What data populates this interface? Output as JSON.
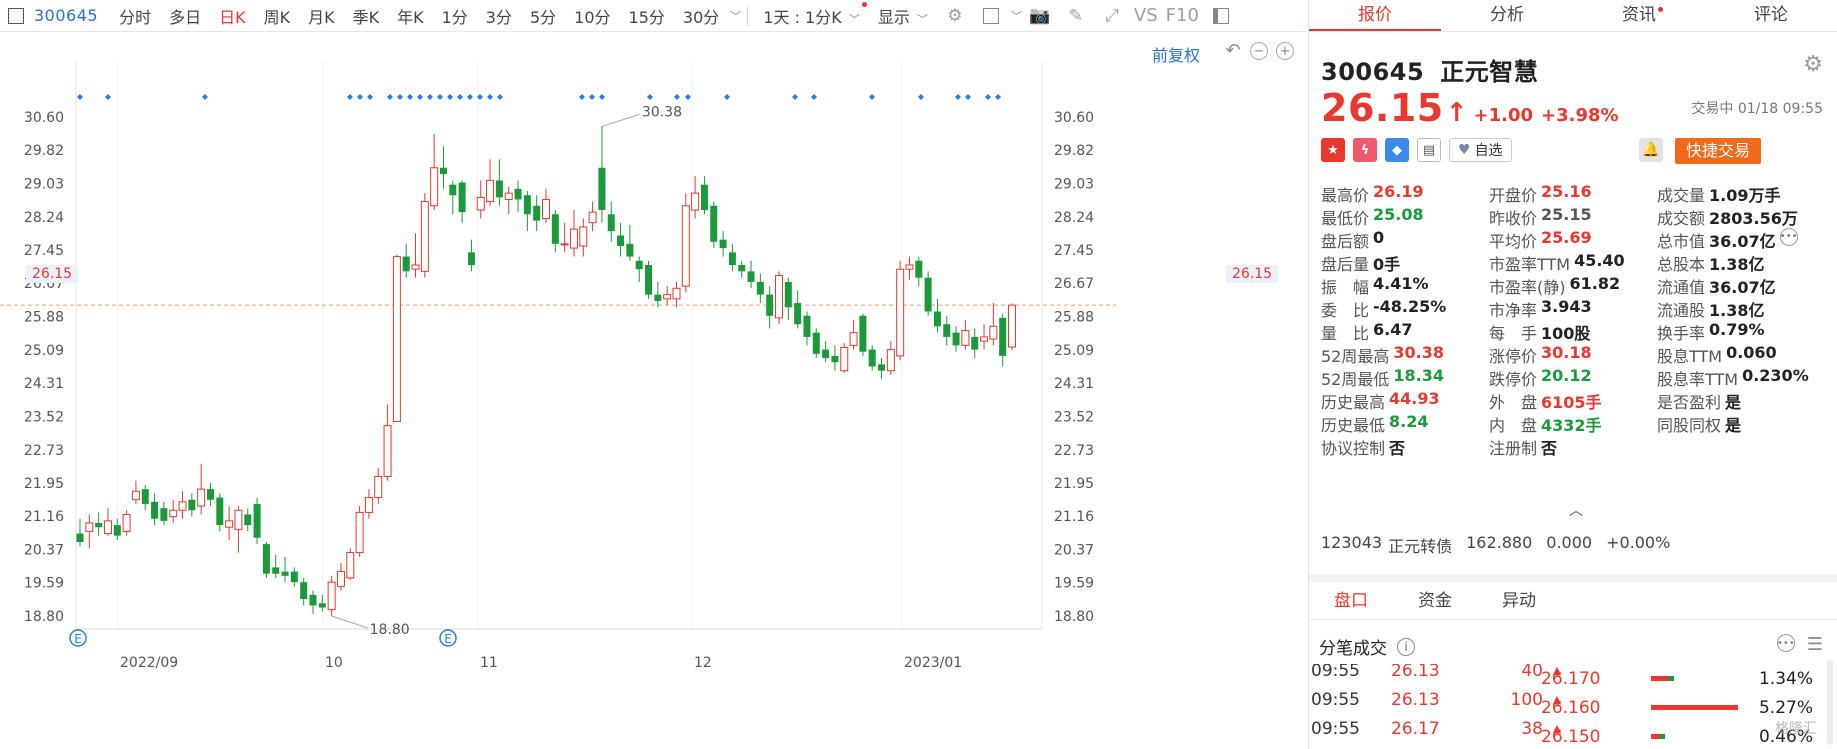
{
  "toolbar": {
    "code": "300645",
    "periods": [
      {
        "label": "分时",
        "active": false
      },
      {
        "label": "多日",
        "active": false
      },
      {
        "label": "日K",
        "active": true
      },
      {
        "label": "周K",
        "active": false
      },
      {
        "label": "月K",
        "active": false
      },
      {
        "label": "季K",
        "active": false
      },
      {
        "label": "年K",
        "active": false
      },
      {
        "label": "1分",
        "active": false
      },
      {
        "label": "3分",
        "active": false
      },
      {
        "label": "5分",
        "active": false
      },
      {
        "label": "10分",
        "active": false
      },
      {
        "label": "15分",
        "active": false
      },
      {
        "label": "30分",
        "active": false
      }
    ],
    "range_select": "1天 : 1分K",
    "display_label": "显示",
    "vs_label": "VS",
    "f10_label": "F10"
  },
  "chart": {
    "adjust_label": "前复权",
    "current_price_tag": "26.15",
    "high_label": "30.38",
    "low_label": "18.80",
    "event_markers": [
      "E",
      "E"
    ]
  },
  "chart_data": {
    "type": "candlestick",
    "ylim": [
      18.8,
      30.6
    ],
    "y_ticks": [
      "30.60",
      "29.82",
      "29.03",
      "28.24",
      "27.45",
      "26.67",
      "25.88",
      "25.09",
      "24.31",
      "23.52",
      "22.73",
      "21.95",
      "21.16",
      "20.37",
      "19.59",
      "18.80"
    ],
    "x_ticks": [
      "2022/09",
      "10",
      "11",
      "12",
      "2023/01"
    ],
    "current_price": 26.15,
    "period_high": 30.38,
    "period_low": 18.8,
    "series": [
      {
        "o": 20.75,
        "c": 20.55,
        "h": 21.1,
        "l": 20.45
      },
      {
        "o": 20.8,
        "c": 21.0,
        "h": 21.2,
        "l": 20.4
      },
      {
        "o": 21.0,
        "c": 20.9,
        "h": 21.25,
        "l": 20.7
      },
      {
        "o": 20.75,
        "c": 21.05,
        "h": 21.35,
        "l": 20.7
      },
      {
        "o": 20.95,
        "c": 20.7,
        "h": 21.1,
        "l": 20.6
      },
      {
        "o": 20.8,
        "c": 21.2,
        "h": 21.3,
        "l": 20.7
      },
      {
        "o": 21.55,
        "c": 21.75,
        "h": 22.0,
        "l": 21.45
      },
      {
        "o": 21.8,
        "c": 21.45,
        "h": 21.9,
        "l": 21.3
      },
      {
        "o": 21.5,
        "c": 21.1,
        "h": 21.7,
        "l": 20.95
      },
      {
        "o": 21.35,
        "c": 21.05,
        "h": 21.5,
        "l": 20.95
      },
      {
        "o": 21.15,
        "c": 21.3,
        "h": 21.55,
        "l": 21.0
      },
      {
        "o": 21.3,
        "c": 21.5,
        "h": 21.75,
        "l": 21.1
      },
      {
        "o": 21.55,
        "c": 21.3,
        "h": 21.7,
        "l": 21.15
      },
      {
        "o": 21.4,
        "c": 21.8,
        "h": 22.4,
        "l": 21.2
      },
      {
        "o": 21.8,
        "c": 21.55,
        "h": 21.95,
        "l": 21.4
      },
      {
        "o": 21.6,
        "c": 20.95,
        "h": 21.7,
        "l": 20.8
      },
      {
        "o": 20.9,
        "c": 21.05,
        "h": 21.4,
        "l": 20.6
      },
      {
        "o": 20.85,
        "c": 21.3,
        "h": 21.4,
        "l": 20.3
      },
      {
        "o": 21.2,
        "c": 20.95,
        "h": 21.35,
        "l": 20.8
      },
      {
        "o": 21.45,
        "c": 20.65,
        "h": 21.6,
        "l": 20.5
      },
      {
        "o": 20.5,
        "c": 19.8,
        "h": 20.55,
        "l": 19.7
      },
      {
        "o": 19.95,
        "c": 19.8,
        "h": 20.25,
        "l": 19.7
      },
      {
        "o": 19.85,
        "c": 19.75,
        "h": 20.2,
        "l": 19.6
      },
      {
        "o": 19.85,
        "c": 19.6,
        "h": 19.95,
        "l": 19.5
      },
      {
        "o": 19.6,
        "c": 19.2,
        "h": 19.7,
        "l": 19.05
      },
      {
        "o": 19.3,
        "c": 19.05,
        "h": 19.4,
        "l": 18.85
      },
      {
        "o": 19.1,
        "c": 19.0,
        "h": 19.3,
        "l": 18.9
      },
      {
        "o": 18.95,
        "c": 19.6,
        "h": 19.75,
        "l": 18.8
      },
      {
        "o": 19.5,
        "c": 19.85,
        "h": 20.05,
        "l": 19.4
      },
      {
        "o": 19.7,
        "c": 20.3,
        "h": 20.4,
        "l": 19.65
      },
      {
        "o": 20.3,
        "c": 21.25,
        "h": 21.4,
        "l": 20.2
      },
      {
        "o": 21.25,
        "c": 21.6,
        "h": 21.8,
        "l": 21.1
      },
      {
        "o": 21.6,
        "c": 22.1,
        "h": 22.3,
        "l": 21.45
      },
      {
        "o": 22.1,
        "c": 23.3,
        "h": 23.8,
        "l": 22.0
      },
      {
        "o": 23.4,
        "c": 27.3,
        "h": 27.35,
        "l": 23.4
      },
      {
        "o": 27.3,
        "c": 26.95,
        "h": 27.6,
        "l": 26.8
      },
      {
        "o": 27.0,
        "c": 27.1,
        "h": 27.85,
        "l": 26.8
      },
      {
        "o": 26.95,
        "c": 28.6,
        "h": 28.8,
        "l": 26.8
      },
      {
        "o": 28.5,
        "c": 29.4,
        "h": 30.2,
        "l": 28.4
      },
      {
        "o": 29.4,
        "c": 29.25,
        "h": 29.9,
        "l": 28.9
      },
      {
        "o": 29.0,
        "c": 28.75,
        "h": 29.1,
        "l": 28.3
      },
      {
        "o": 29.05,
        "c": 28.35,
        "h": 29.1,
        "l": 28.1
      },
      {
        "o": 27.4,
        "c": 27.1,
        "h": 27.7,
        "l": 26.95
      },
      {
        "o": 28.4,
        "c": 28.7,
        "h": 29.1,
        "l": 28.2
      },
      {
        "o": 28.6,
        "c": 29.1,
        "h": 29.6,
        "l": 28.5
      },
      {
        "o": 29.1,
        "c": 28.7,
        "h": 29.6,
        "l": 28.5
      },
      {
        "o": 28.65,
        "c": 28.8,
        "h": 28.95,
        "l": 28.3
      },
      {
        "o": 28.9,
        "c": 28.65,
        "h": 29.1,
        "l": 28.35
      },
      {
        "o": 28.75,
        "c": 28.3,
        "h": 28.85,
        "l": 27.9
      },
      {
        "o": 28.5,
        "c": 28.15,
        "h": 28.75,
        "l": 27.9
      },
      {
        "o": 28.2,
        "c": 28.65,
        "h": 28.9,
        "l": 28.1
      },
      {
        "o": 28.3,
        "c": 27.6,
        "h": 28.4,
        "l": 27.4
      },
      {
        "o": 27.6,
        "c": 27.6,
        "h": 28.1,
        "l": 27.4
      },
      {
        "o": 27.5,
        "c": 27.95,
        "h": 28.4,
        "l": 27.3
      },
      {
        "o": 27.55,
        "c": 28.0,
        "h": 28.2,
        "l": 27.3
      },
      {
        "o": 28.1,
        "c": 28.35,
        "h": 28.6,
        "l": 27.9
      },
      {
        "o": 29.4,
        "c": 28.4,
        "h": 30.38,
        "l": 28.1
      },
      {
        "o": 28.3,
        "c": 27.9,
        "h": 28.6,
        "l": 27.65
      },
      {
        "o": 27.8,
        "c": 27.55,
        "h": 28.1,
        "l": 27.3
      },
      {
        "o": 27.6,
        "c": 27.3,
        "h": 28.05,
        "l": 27.2
      },
      {
        "o": 27.2,
        "c": 27.0,
        "h": 27.3,
        "l": 26.7
      },
      {
        "o": 27.1,
        "c": 26.4,
        "h": 27.2,
        "l": 26.3
      },
      {
        "o": 26.4,
        "c": 26.25,
        "h": 26.7,
        "l": 26.1
      },
      {
        "o": 26.3,
        "c": 26.4,
        "h": 26.6,
        "l": 26.15
      },
      {
        "o": 26.3,
        "c": 26.55,
        "h": 26.7,
        "l": 26.1
      },
      {
        "o": 26.6,
        "c": 28.5,
        "h": 28.8,
        "l": 26.45
      },
      {
        "o": 28.4,
        "c": 28.8,
        "h": 29.2,
        "l": 28.2
      },
      {
        "o": 29.0,
        "c": 28.4,
        "h": 29.2,
        "l": 28.3
      },
      {
        "o": 28.5,
        "c": 27.65,
        "h": 28.6,
        "l": 27.5
      },
      {
        "o": 27.7,
        "c": 27.5,
        "h": 27.9,
        "l": 27.3
      },
      {
        "o": 27.4,
        "c": 27.1,
        "h": 27.6,
        "l": 26.95
      },
      {
        "o": 27.1,
        "c": 26.95,
        "h": 27.2,
        "l": 26.8
      },
      {
        "o": 26.95,
        "c": 26.7,
        "h": 27.2,
        "l": 26.55
      },
      {
        "o": 26.7,
        "c": 26.4,
        "h": 26.9,
        "l": 26.2
      },
      {
        "o": 26.4,
        "c": 25.9,
        "h": 26.6,
        "l": 25.6
      },
      {
        "o": 25.85,
        "c": 26.85,
        "h": 26.95,
        "l": 25.7
      },
      {
        "o": 26.7,
        "c": 26.1,
        "h": 26.8,
        "l": 25.8
      },
      {
        "o": 26.2,
        "c": 25.7,
        "h": 26.5,
        "l": 25.6
      },
      {
        "o": 25.9,
        "c": 25.4,
        "h": 26.0,
        "l": 25.2
      },
      {
        "o": 25.5,
        "c": 25.0,
        "h": 25.6,
        "l": 24.9
      },
      {
        "o": 25.1,
        "c": 24.9,
        "h": 25.3,
        "l": 24.8
      },
      {
        "o": 24.95,
        "c": 24.8,
        "h": 25.2,
        "l": 24.6
      },
      {
        "o": 24.6,
        "c": 25.15,
        "h": 25.25,
        "l": 24.55
      },
      {
        "o": 25.2,
        "c": 25.5,
        "h": 25.8,
        "l": 25.1
      },
      {
        "o": 25.9,
        "c": 25.05,
        "h": 25.95,
        "l": 24.95
      },
      {
        "o": 25.1,
        "c": 24.7,
        "h": 25.2,
        "l": 24.6
      },
      {
        "o": 24.75,
        "c": 24.6,
        "h": 24.9,
        "l": 24.4
      },
      {
        "o": 24.6,
        "c": 25.1,
        "h": 25.3,
        "l": 24.5
      },
      {
        "o": 24.95,
        "c": 27.0,
        "h": 27.2,
        "l": 24.85
      },
      {
        "o": 27.0,
        "c": 27.1,
        "h": 27.3,
        "l": 26.75
      },
      {
        "o": 27.2,
        "c": 26.8,
        "h": 27.3,
        "l": 26.6
      },
      {
        "o": 26.8,
        "c": 26.0,
        "h": 26.95,
        "l": 25.9
      },
      {
        "o": 26.0,
        "c": 25.65,
        "h": 26.3,
        "l": 25.5
      },
      {
        "o": 25.7,
        "c": 25.4,
        "h": 25.9,
        "l": 25.2
      },
      {
        "o": 25.5,
        "c": 25.2,
        "h": 25.65,
        "l": 25.05
      },
      {
        "o": 25.2,
        "c": 25.55,
        "h": 25.8,
        "l": 25.1
      },
      {
        "o": 25.4,
        "c": 25.1,
        "h": 25.6,
        "l": 24.9
      },
      {
        "o": 25.3,
        "c": 25.4,
        "h": 25.7,
        "l": 25.1
      },
      {
        "o": 25.35,
        "c": 25.65,
        "h": 26.2,
        "l": 25.2
      },
      {
        "o": 25.85,
        "c": 24.95,
        "h": 25.95,
        "l": 24.7
      },
      {
        "o": 25.16,
        "c": 26.15,
        "h": 26.19,
        "l": 25.08
      }
    ]
  },
  "quote": {
    "tabs": [
      {
        "label": "报价",
        "active": true,
        "badge": false
      },
      {
        "label": "分析",
        "active": false,
        "badge": false
      },
      {
        "label": "资讯",
        "active": false,
        "badge": true
      },
      {
        "label": "评论",
        "active": false,
        "badge": false
      }
    ],
    "code": "300645",
    "name": "正元智慧",
    "price": "26.15",
    "arrow": "↑",
    "change": "+1.00",
    "change_pct": "+3.98%",
    "status": "交易中 01/18 09:55",
    "fav_label": "自选",
    "quick_trade": "快捷交易",
    "icon_tags": [
      "CN",
      "闪",
      "标",
      "账"
    ],
    "stats": [
      [
        {
          "label": "最高价",
          "value": "26.19",
          "tone": "up"
        },
        {
          "label": "开盘价",
          "value": "25.16",
          "tone": "up"
        },
        {
          "label": "成交量",
          "value": "1.09万手",
          "tone": ""
        }
      ],
      [
        {
          "label": "最低价",
          "value": "25.08",
          "tone": "down"
        },
        {
          "label": "昨收价",
          "value": "25.15",
          "tone": "grey"
        },
        {
          "label": "成交额",
          "value": "2803.56万",
          "tone": ""
        }
      ],
      [
        {
          "label": "盘后额",
          "value": "0",
          "tone": ""
        },
        {
          "label": "平均价",
          "value": "25.69",
          "tone": "up"
        },
        {
          "label": "总市值",
          "value": "36.07亿",
          "tone": "",
          "more": true
        }
      ],
      [
        {
          "label": "盘后量",
          "value": "0手",
          "tone": ""
        },
        {
          "label": "市盈率TTM",
          "value": "45.40",
          "tone": ""
        },
        {
          "label": "总股本",
          "value": "1.38亿",
          "tone": ""
        }
      ],
      [
        {
          "label": "振　幅",
          "value": "4.41%",
          "tone": ""
        },
        {
          "label": "市盈率(静)",
          "value": "61.82",
          "tone": ""
        },
        {
          "label": "流通值",
          "value": "36.07亿",
          "tone": ""
        }
      ],
      [
        {
          "label": "委　比",
          "value": "-48.25%",
          "tone": ""
        },
        {
          "label": "市净率",
          "value": "3.943",
          "tone": ""
        },
        {
          "label": "流通股",
          "value": "1.38亿",
          "tone": ""
        }
      ],
      [
        {
          "label": "量　比",
          "value": "6.47",
          "tone": ""
        },
        {
          "label": "每　手",
          "value": "100股",
          "tone": ""
        },
        {
          "label": "换手率",
          "value": "0.79%",
          "tone": ""
        }
      ],
      [
        {
          "label": "52周最高",
          "value": "30.38",
          "tone": "up"
        },
        {
          "label": "涨停价",
          "value": "30.18",
          "tone": "up"
        },
        {
          "label": "股息TTM",
          "value": "0.060",
          "tone": ""
        }
      ],
      [
        {
          "label": "52周最低",
          "value": "18.34",
          "tone": "down"
        },
        {
          "label": "跌停价",
          "value": "20.12",
          "tone": "down"
        },
        {
          "label": "股息率TTM",
          "value": "0.230%",
          "tone": ""
        }
      ],
      [
        {
          "label": "历史最高",
          "value": "44.93",
          "tone": "up"
        },
        {
          "label": "外　盘",
          "value": "6105手",
          "tone": "up"
        },
        {
          "label": "是否盈利",
          "value": "是",
          "tone": ""
        }
      ],
      [
        {
          "label": "历史最低",
          "value": "8.24",
          "tone": "down"
        },
        {
          "label": "内　盘",
          "value": "4332手",
          "tone": "down"
        },
        {
          "label": "同股同权",
          "value": "是",
          "tone": ""
        }
      ],
      [
        {
          "label": "协议控制",
          "value": "否",
          "tone": ""
        },
        {
          "label": "注册制",
          "value": "否",
          "tone": ""
        },
        {
          "label": "",
          "value": "",
          "tone": ""
        }
      ]
    ],
    "bond": {
      "code": "123043",
      "name": "正元转债",
      "price": "162.880",
      "change": "0.000",
      "pct": "+0.00%"
    },
    "subtabs": [
      {
        "label": "盘口",
        "active": true
      },
      {
        "label": "资金",
        "active": false
      },
      {
        "label": "异动",
        "active": false
      }
    ],
    "ticks_title": "分笔成交",
    "ticks": [
      {
        "time": "09:55",
        "price": "26.13",
        "vol": "40"
      },
      {
        "time": "09:55",
        "price": "26.13",
        "vol": "100"
      },
      {
        "time": "09:55",
        "price": "26.17",
        "vol": "38"
      }
    ],
    "distribution": [
      {
        "price": "26.170",
        "pct": "1.34%",
        "share": 0.2,
        "green": 0.05
      },
      {
        "price": "26.160",
        "pct": "5.27%",
        "share": 0.95,
        "green": 0.0
      },
      {
        "price": "26.150",
        "pct": "0.46%",
        "share": 0.1,
        "green": 0.05
      }
    ],
    "watermark": "格隆汇"
  },
  "colors": {
    "up": "#e8382f",
    "down": "#1b9a3c",
    "accent": "#2a6fd6"
  }
}
